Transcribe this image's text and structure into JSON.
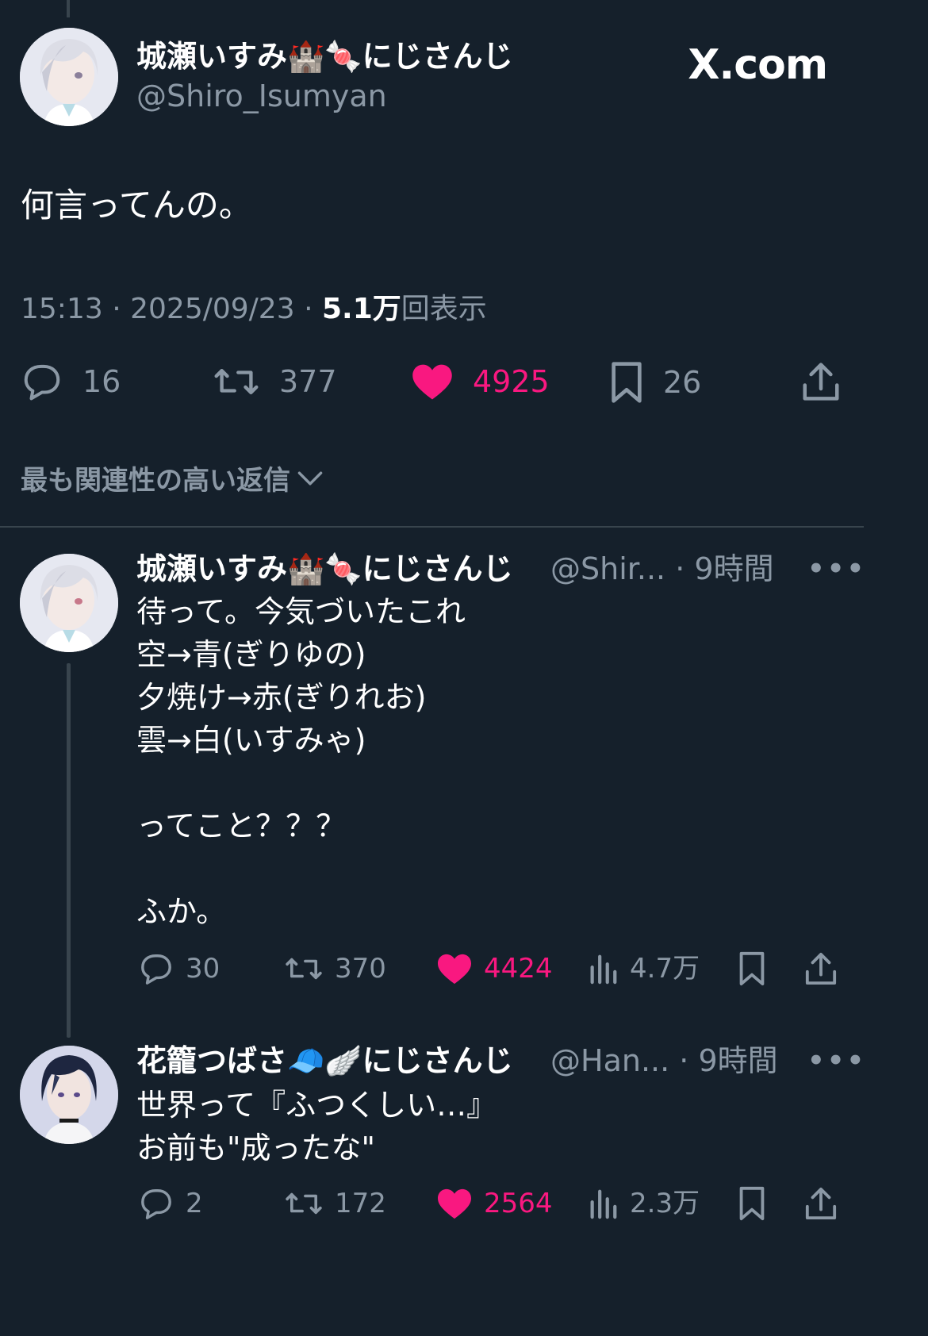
{
  "brand": "X.com",
  "main_tweet": {
    "author_name": "城瀬いすみ🏰🍬にじさんじ",
    "author_handle": "@Shiro_Isumyan",
    "text": "何言ってんの。",
    "time": "15:13",
    "date": "2025/09/23",
    "views_number": "5.1万",
    "views_label": "回表示",
    "separator": "·",
    "replies": "16",
    "retweets": "377",
    "likes": "4925",
    "bookmarks": "26"
  },
  "sort_label": "最も関連性の高い返信",
  "replies": [
    {
      "author_name": "城瀬いすみ🏰🍬にじさんじ",
      "handle": "@Shir...",
      "time": "· 9時間",
      "text": "待って。今気づいたこれ\n空→青(ぎりゆの)\n夕焼け→赤(ぎりれお)\n雲→白(いすみゃ)\n\nってこと？？？\n\nふか。",
      "replies": "30",
      "retweets": "370",
      "likes": "4424",
      "views": "4.7万"
    },
    {
      "author_name": "花籠つばさ🧢🪽にじさんじ",
      "handle": "@Han...",
      "time": "· 9時間",
      "text": "世界って『ふつくしい…』\nお前も\"成ったな\"",
      "replies": "2",
      "retweets": "172",
      "likes": "2564",
      "views": "2.3万"
    }
  ],
  "more_glyph": "•••",
  "icons": {
    "reply": "reply-icon",
    "retweet": "retweet-icon",
    "like": "heart-icon",
    "bookmark": "bookmark-icon",
    "share": "share-icon",
    "views": "views-icon",
    "chevron": "chevron-down-icon"
  },
  "colors": {
    "background": "#15202b",
    "like_pink": "#f91880",
    "muted": "#8b98a5",
    "divider": "#38444d"
  }
}
